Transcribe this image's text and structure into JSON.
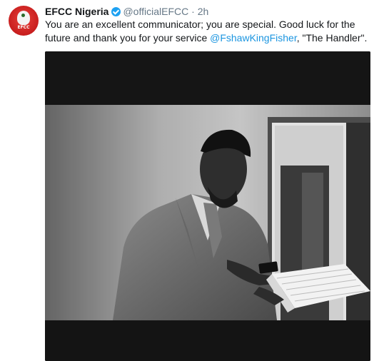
{
  "author": {
    "display_name": "EFCC Nigeria",
    "handle": "@officialEFCC",
    "separator": "·",
    "timestamp": "2h",
    "avatar_text": "EFCC",
    "verified_icon": "verified-badge-icon"
  },
  "tweet": {
    "text_before": "You are an excellent communicator; you are special. Good luck for the future and thank you for your service ",
    "mention": "@FshawKingFisher",
    "text_after": ", \"The Handler\"."
  },
  "media": {
    "type": "photo"
  },
  "colors": {
    "link": "#1b95e0",
    "verified": "#1da1f2",
    "secondary_text": "#657786",
    "avatar_red": "#c81e1e"
  }
}
